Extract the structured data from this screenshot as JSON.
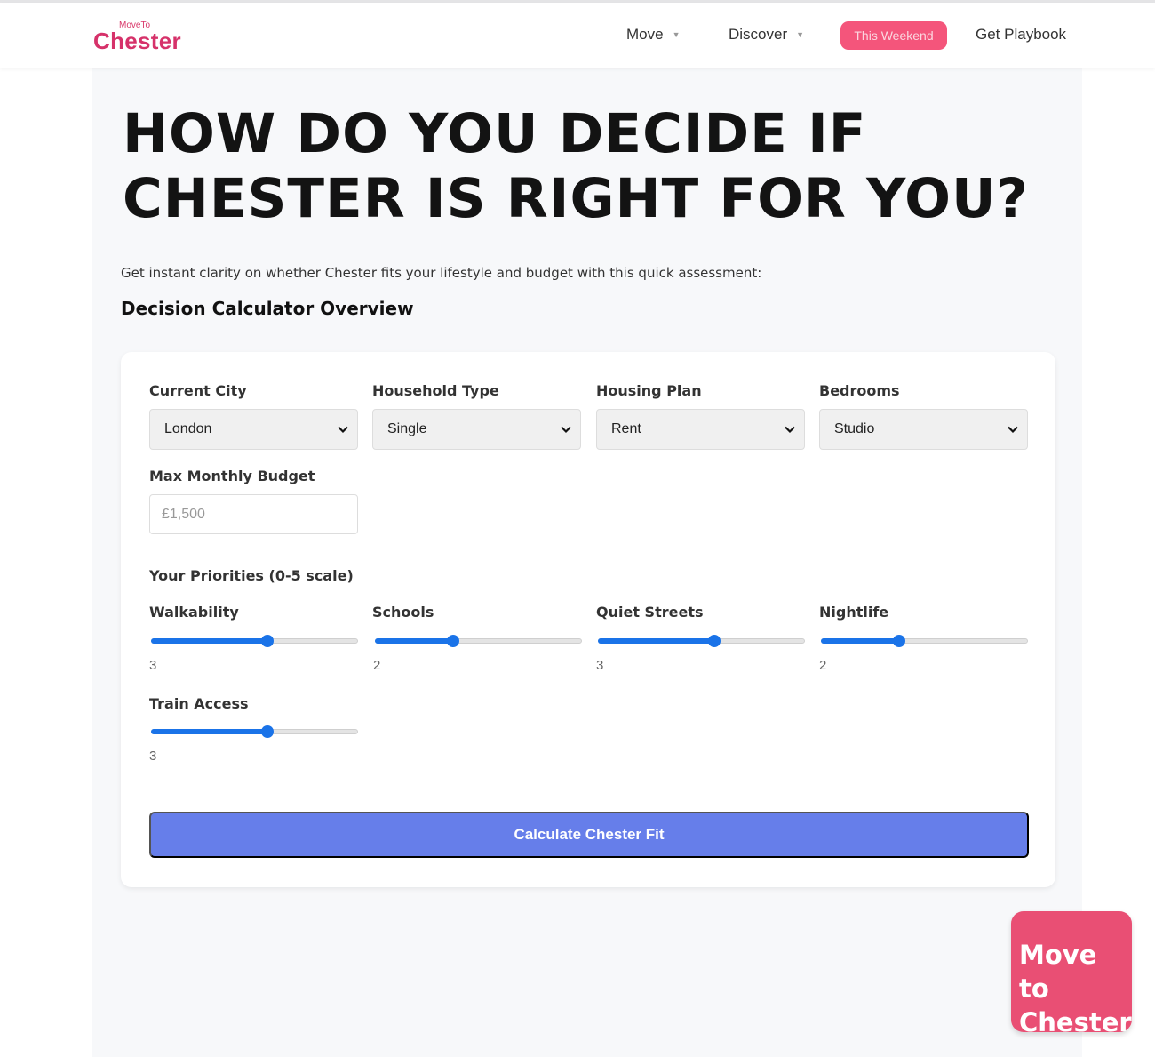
{
  "nav": {
    "logo_small": "MoveTo",
    "logo_main": "Chester",
    "move": "Move",
    "discover": "Discover",
    "this_weekend": "This Weekend",
    "playbook": "Get Playbook"
  },
  "hero": {
    "title_line1": "HOW DO YOU DECIDE IF",
    "title_line2": "CHESTER IS RIGHT FOR YOU?",
    "intro": "Get instant clarity on whether Chester fits your lifestyle and budget with this quick assessment:",
    "subhead": "Decision Calculator Overview"
  },
  "form": {
    "city": {
      "label": "Current City",
      "value": "London"
    },
    "household": {
      "label": "Household Type",
      "value": "Single"
    },
    "housing": {
      "label": "Housing Plan",
      "value": "Rent"
    },
    "bedrooms": {
      "label": "Bedrooms",
      "value": "Studio"
    },
    "budget": {
      "label": "Max Monthly Budget",
      "placeholder": "£1,500"
    },
    "priorities_label": "Your Priorities (0-5 scale)",
    "priorities": [
      {
        "label": "Walkability",
        "value": 3,
        "value_text": "3"
      },
      {
        "label": "Schools",
        "value": 2,
        "value_text": "2"
      },
      {
        "label": "Quiet Streets",
        "value": 3,
        "value_text": "3"
      },
      {
        "label": "Nightlife",
        "value": 2,
        "value_text": "2"
      },
      {
        "label": "Train Access",
        "value": 3,
        "value_text": "3"
      }
    ],
    "priority_max": 5,
    "submit": "Calculate Chester Fit"
  },
  "cta": {
    "line1": "Move to",
    "line2": "Chester"
  },
  "colors": {
    "brand": "#d6326a",
    "accent_button": "#667eea",
    "slider": "#1a73e8",
    "weekend_pill": "#f4557b",
    "cta": "#e94f74"
  }
}
